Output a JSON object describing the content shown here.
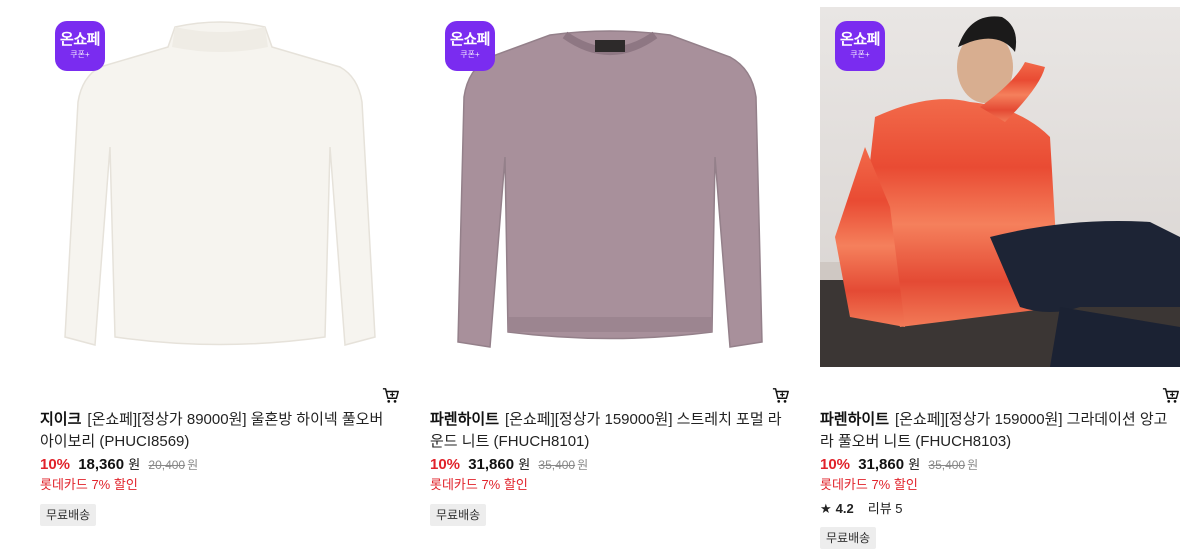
{
  "badge": {
    "main": "온쇼페",
    "sub": "쿠폰+"
  },
  "currency_unit": "원",
  "products": [
    {
      "brand": "지이크",
      "name": "[온쇼페][정상가 89000원] 울혼방 하이넥 풀오버 아이보리 (PHUCI8569)",
      "discount": "10%",
      "price": "18,360",
      "original_price": "20,400",
      "card_promo": "롯데카드 7% 할인",
      "tag": "무료배송",
      "image_color": "#f6f4ef"
    },
    {
      "brand": "파렌하이트",
      "name": "[온쇼페][정상가 159000원] 스트레치 포멀 라운드 니트 (FHUCH8101)",
      "discount": "10%",
      "price": "31,860",
      "original_price": "35,400",
      "card_promo": "롯데카드 7% 할인",
      "tag": "무료배송",
      "image_color": "#a8909b"
    },
    {
      "brand": "파렌하이트",
      "name": "[온쇼페][정상가 159000원] 그라데이션 앙고라 풀오버 니트 (FHUCH8103)",
      "discount": "10%",
      "price": "31,860",
      "original_price": "35,400",
      "card_promo": "롯데카드 7% 할인",
      "rating_score": "4.2",
      "review_label": "리뷰 5",
      "tag": "무료배송",
      "image_color": "#e85a3f"
    }
  ]
}
